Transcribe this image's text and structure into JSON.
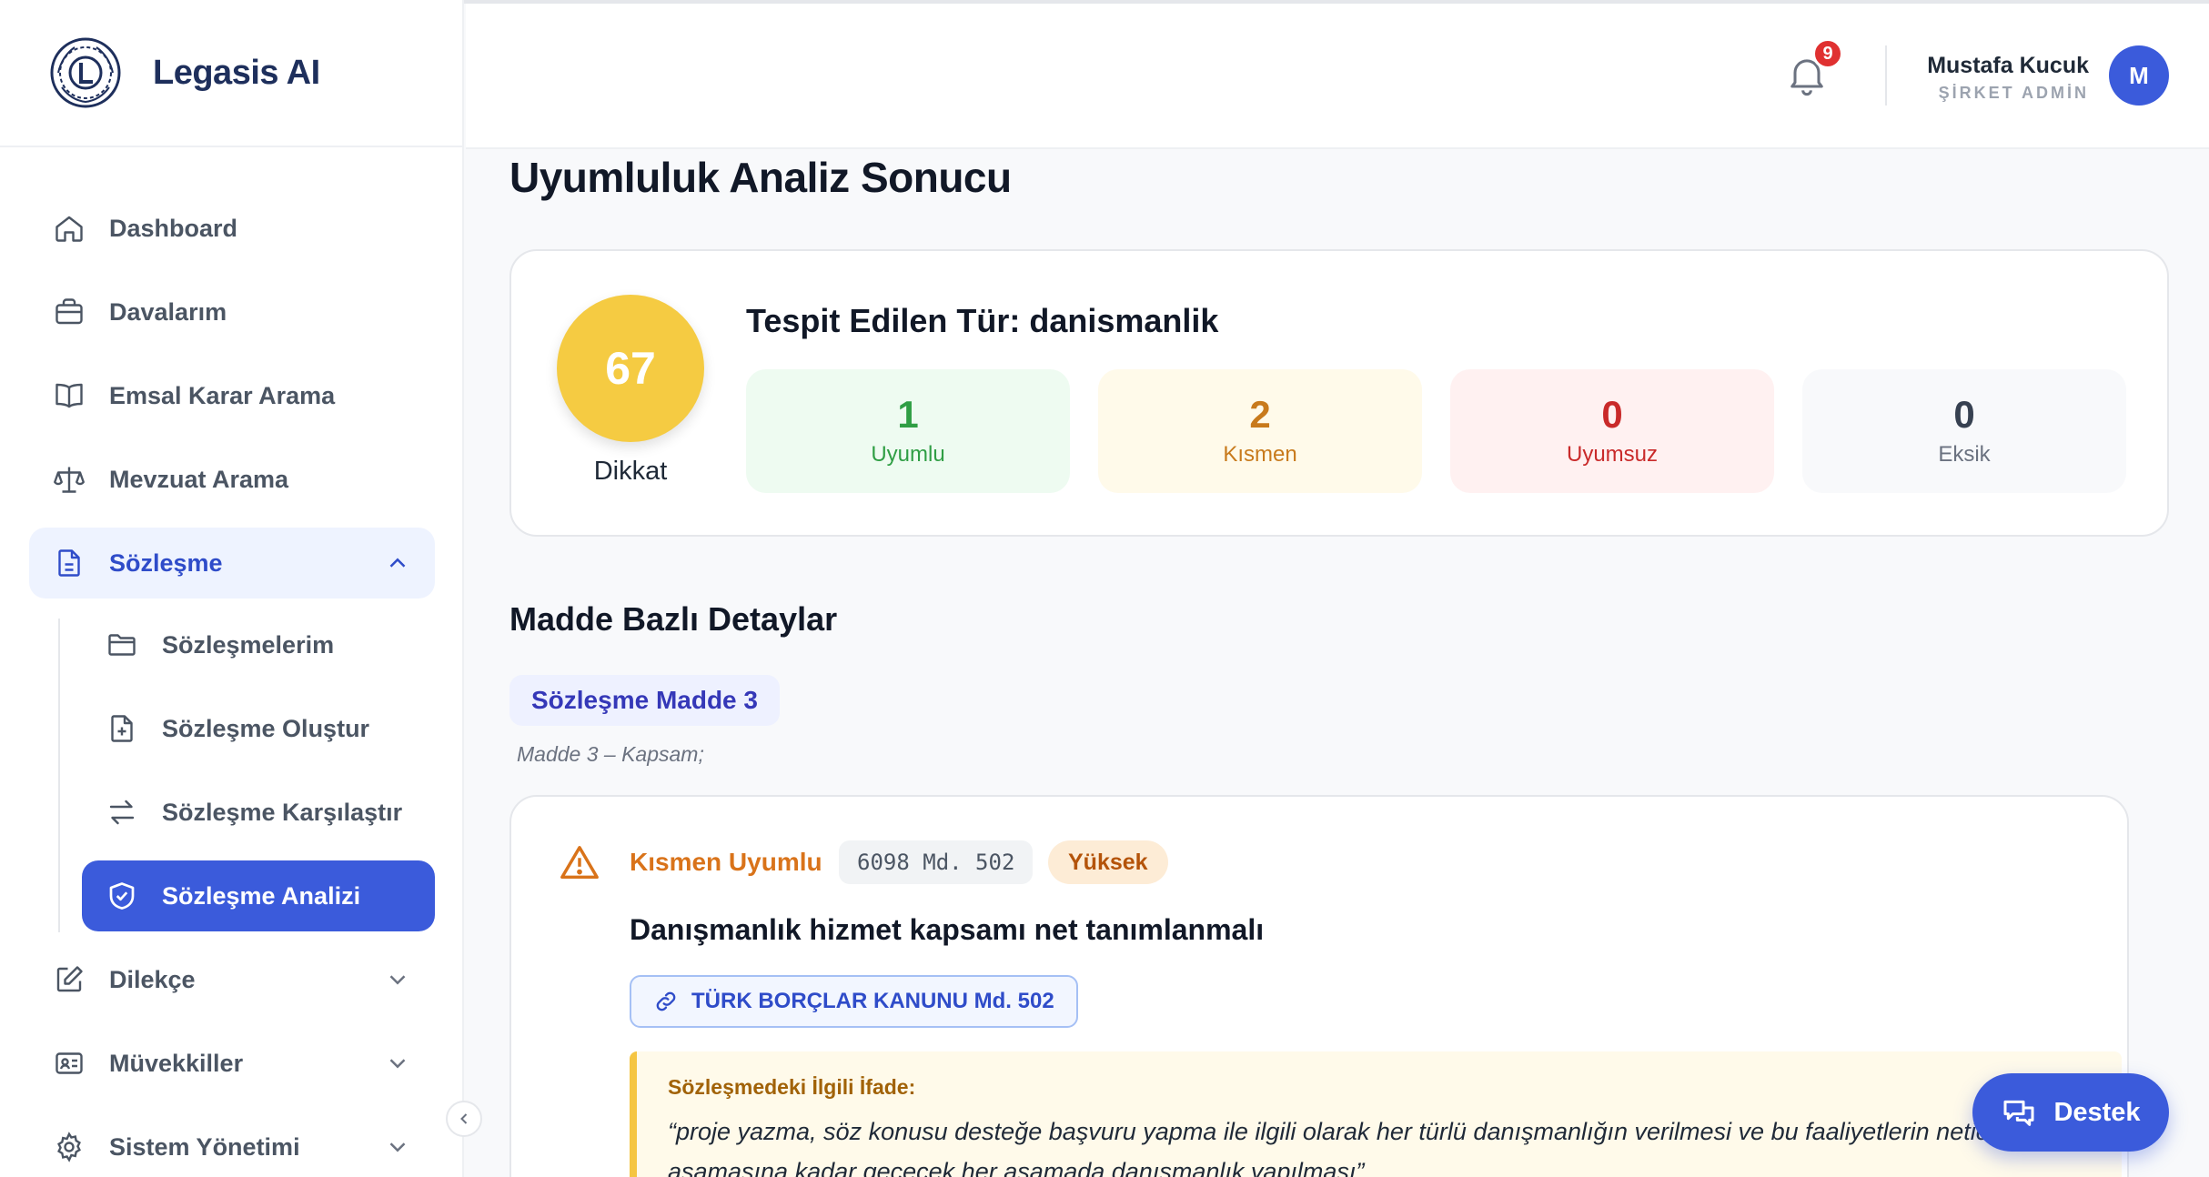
{
  "brand": {
    "name": "Legasis AI"
  },
  "sidebar": {
    "items": [
      {
        "id": "dashboard",
        "label": "Dashboard",
        "icon": "home-icon"
      },
      {
        "id": "davalarim",
        "label": "Davalarım",
        "icon": "briefcase-icon"
      },
      {
        "id": "emsal",
        "label": "Emsal Karar Arama",
        "icon": "book-icon"
      },
      {
        "id": "mevzuat",
        "label": "Mevzuat Arama",
        "icon": "scale-icon"
      },
      {
        "id": "sozlesme",
        "label": "Sözleşme",
        "icon": "document-icon",
        "expanded": true
      },
      {
        "id": "dilekce",
        "label": "Dilekçe",
        "icon": "edit-icon"
      },
      {
        "id": "muvekkiller",
        "label": "Müvekkiller",
        "icon": "contact-card-icon"
      },
      {
        "id": "sistem",
        "label": "Sistem Yönetimi",
        "icon": "gear-icon"
      }
    ],
    "sub_items": [
      {
        "id": "sozlesmelerim",
        "label": "Sözleşmelerim",
        "icon": "folder-icon"
      },
      {
        "id": "olustur",
        "label": "Sözleşme Oluştur",
        "icon": "file-plus-icon"
      },
      {
        "id": "karsilastir",
        "label": "Sözleşme Karşılaştır",
        "icon": "swap-icon"
      },
      {
        "id": "analizi",
        "label": "Sözleşme Analizi",
        "icon": "shield-check-icon",
        "active": true
      }
    ]
  },
  "header": {
    "notification_count": "9",
    "user_name": "Mustafa Kucuk",
    "user_role": "ŞİRKET ADMİN",
    "avatar_initial": "M"
  },
  "page": {
    "title": "Uyumluluk Analiz Sonucu"
  },
  "summary": {
    "score": "67",
    "score_label": "Dikkat",
    "detected_type": "Tespit Edilen Tür: danismanlik",
    "stats": [
      {
        "value": "1",
        "label": "Uyumlu",
        "color": "#2f9e44"
      },
      {
        "value": "2",
        "label": "Kısmen",
        "color": "#c87a1c"
      },
      {
        "value": "0",
        "label": "Uyumsuz",
        "color": "#c92a2a"
      },
      {
        "value": "0",
        "label": "Eksik",
        "color": "#374151"
      }
    ]
  },
  "details": {
    "section_title": "Madde Bazlı Detaylar",
    "madde_chip": "Sözleşme Madde 3",
    "madde_sub": "Madde 3 – Kapsam;",
    "finding": {
      "status": "Kısmen Uyumlu",
      "reference": "6098 Md. 502",
      "severity": "Yüksek",
      "title": "Danışmanlık hizmet kapsamı net tanımlanmalı",
      "law_link": "TÜRK BORÇLAR KANUNU Md. 502",
      "quote_label": "Sözleşmedeki İlgili İfade:",
      "quote_text": "“proje yazma, söz konusu desteğe başvuru yapma ile ilgili olarak her türlü danışmanlığın verilmesi ve bu faaliyetlerin neticelenmesi aşamasına kadar geçecek her aşamada danışmanlık yapılması”"
    }
  },
  "support": {
    "label": "Destek"
  },
  "colors": {
    "primary": "#3b5bdb",
    "score": "#f5cb42",
    "warning": "#d9731a"
  }
}
